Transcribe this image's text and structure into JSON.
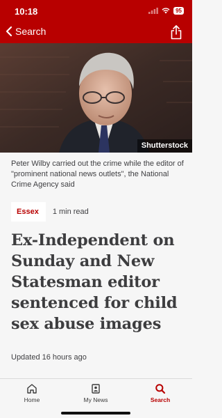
{
  "status_bar": {
    "time": "10:18",
    "battery": "95"
  },
  "nav": {
    "back_label": "Search"
  },
  "hero": {
    "credit": "Shutterstock"
  },
  "article": {
    "caption": "Peter Wilby carried out the crime while the editor of \"prominent national news outlets\", the National Crime Agency said",
    "topic": "Essex",
    "read_time": "1 min read",
    "headline": "Ex-Independent on Sunday and New Statesman editor sentenced for child sex abuse images",
    "updated": "Updated 16 hours ago"
  },
  "tabs": [
    {
      "label": "Home",
      "icon": "home-icon"
    },
    {
      "label": "My News",
      "icon": "my-news-icon"
    },
    {
      "label": "Search",
      "icon": "search-icon",
      "active": true
    }
  ],
  "colors": {
    "brand": "#b80000",
    "text": "#3d3d3f"
  }
}
